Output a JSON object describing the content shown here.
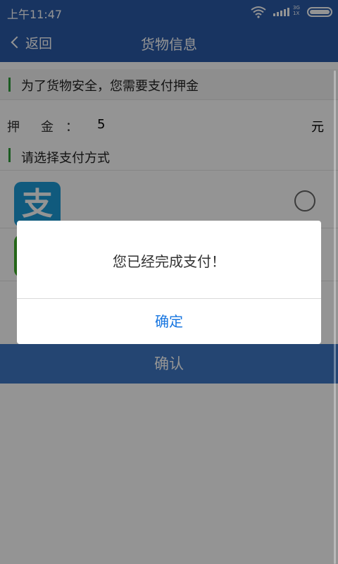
{
  "status_bar": {
    "time": "上午11:47",
    "network_top": "3G",
    "network_bottom": "1X"
  },
  "nav": {
    "back_label": "返回",
    "title": "货物信息"
  },
  "notice": {
    "text": "为了货物安全，您需要支付押金"
  },
  "deposit": {
    "label": "押金",
    "colon": "：",
    "value": "5",
    "unit": "元"
  },
  "payment": {
    "header": "请选择支付方式",
    "alipay_glyph": "支"
  },
  "confirm_button": {
    "label": "确认"
  },
  "dialog": {
    "message": "您已经完成支付！",
    "ok_label": "确定"
  },
  "colors": {
    "brand_blue": "#2a5aa8",
    "accent_green": "#2f9e3a",
    "link_blue": "#1876e0"
  }
}
